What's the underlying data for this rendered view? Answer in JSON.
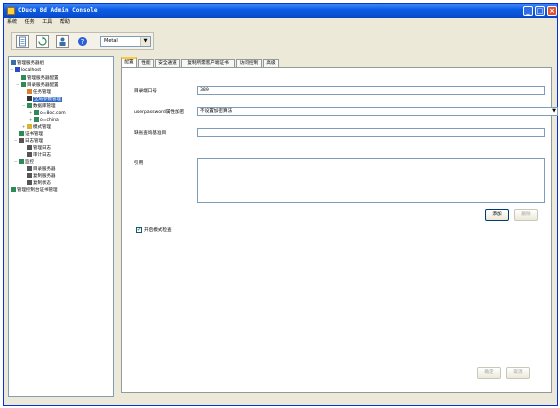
{
  "window": {
    "title": "CDuce 8d  Admin  Console"
  },
  "menu": [
    "系统",
    "任务",
    "工具",
    "帮助"
  ],
  "toolbar": {
    "theme_select": "Metal"
  },
  "tree": [
    {
      "label": "管理服务器组",
      "icon": "server-group-icon",
      "color": "#3a6ea5"
    },
    {
      "label": "localhost",
      "icon": "server-icon",
      "color": "#2a4bd0"
    },
    {
      "label": "管理服务器配置",
      "icon": "settings-icon",
      "color": "#2e8b57"
    },
    {
      "label": "目录服务器配置",
      "icon": "directory-icon",
      "color": "#2e8b57"
    },
    {
      "label": "任务管理",
      "icon": "task-icon",
      "color": "#d9822b"
    },
    {
      "label": "全局参数管理",
      "icon": "globe-icon",
      "color": "#333333"
    },
    {
      "label": "数据库管理",
      "icon": "database-icon",
      "color": "#2e8b57"
    },
    {
      "label": "o=8oc.com",
      "icon": "db-node-icon",
      "color": "#2e8b57"
    },
    {
      "label": "o=china",
      "icon": "db-node-icon",
      "color": "#2e8b57"
    },
    {
      "label": "模式管理",
      "icon": "schema-icon",
      "color": "#d9b32b"
    },
    {
      "label": "证书管理",
      "icon": "certificate-icon",
      "color": "#2e8b57"
    },
    {
      "label": "日志管理",
      "icon": "log-icon",
      "color": "#555555"
    },
    {
      "label": "管理日志",
      "icon": "admin-log-icon",
      "color": "#555555"
    },
    {
      "label": "审计日志",
      "icon": "audit-log-icon",
      "color": "#555555"
    },
    {
      "label": "监控",
      "icon": "monitor-icon",
      "color": "#2e8b57"
    },
    {
      "label": "目录服务器",
      "icon": "dir-server-icon",
      "color": "#555555"
    },
    {
      "label": "复制服务器",
      "icon": "replica-server-icon",
      "color": "#555555"
    },
    {
      "label": "复制状态",
      "icon": "replica-status-icon",
      "color": "#555555"
    },
    {
      "label": "管理控制台证书管理",
      "icon": "console-cert-icon",
      "color": "#2e8b57"
    }
  ],
  "tabs": [
    "配置",
    "性能",
    "安全通道",
    "复制所需客户端证书",
    "访问控制",
    "高级"
  ],
  "form": {
    "port_label": "目录端口号",
    "port_value": "389",
    "encryption_label": "userpassword属性加密",
    "encryption_value": "不设置加密算法",
    "schema_label": "缺省查询基准目",
    "schema_value": "",
    "reference_label": "引用",
    "add_button": "添加",
    "delete_button": "删除",
    "schema_check_label": "开启模式检查",
    "ok_button": "确定",
    "cancel_button": "取消"
  }
}
